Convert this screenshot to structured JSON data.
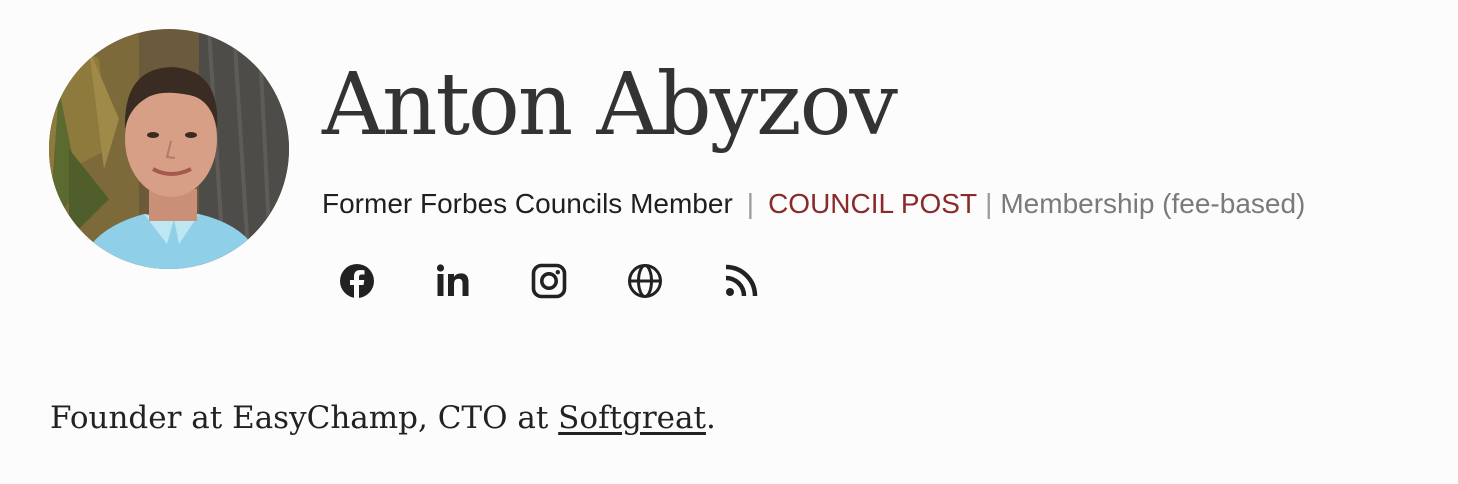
{
  "author": {
    "name": "Anton Abyzov",
    "role": "Former Forbes Councils Member",
    "separator": "|",
    "council_label": "COUNCIL POST",
    "separator2": "|",
    "membership": "Membership (fee-based)"
  },
  "socials": [
    {
      "icon": "facebook-icon"
    },
    {
      "icon": "linkedin-icon"
    },
    {
      "icon": "instagram-icon"
    },
    {
      "icon": "globe-icon"
    },
    {
      "icon": "rss-icon"
    }
  ],
  "bio": {
    "prefix": "Founder at EasyChamp, CTO at ",
    "link_text": "Softgreat",
    "suffix": "."
  },
  "colors": {
    "council": "#8a2a2a",
    "membership": "#7a7a7a",
    "icons": "#222222"
  }
}
